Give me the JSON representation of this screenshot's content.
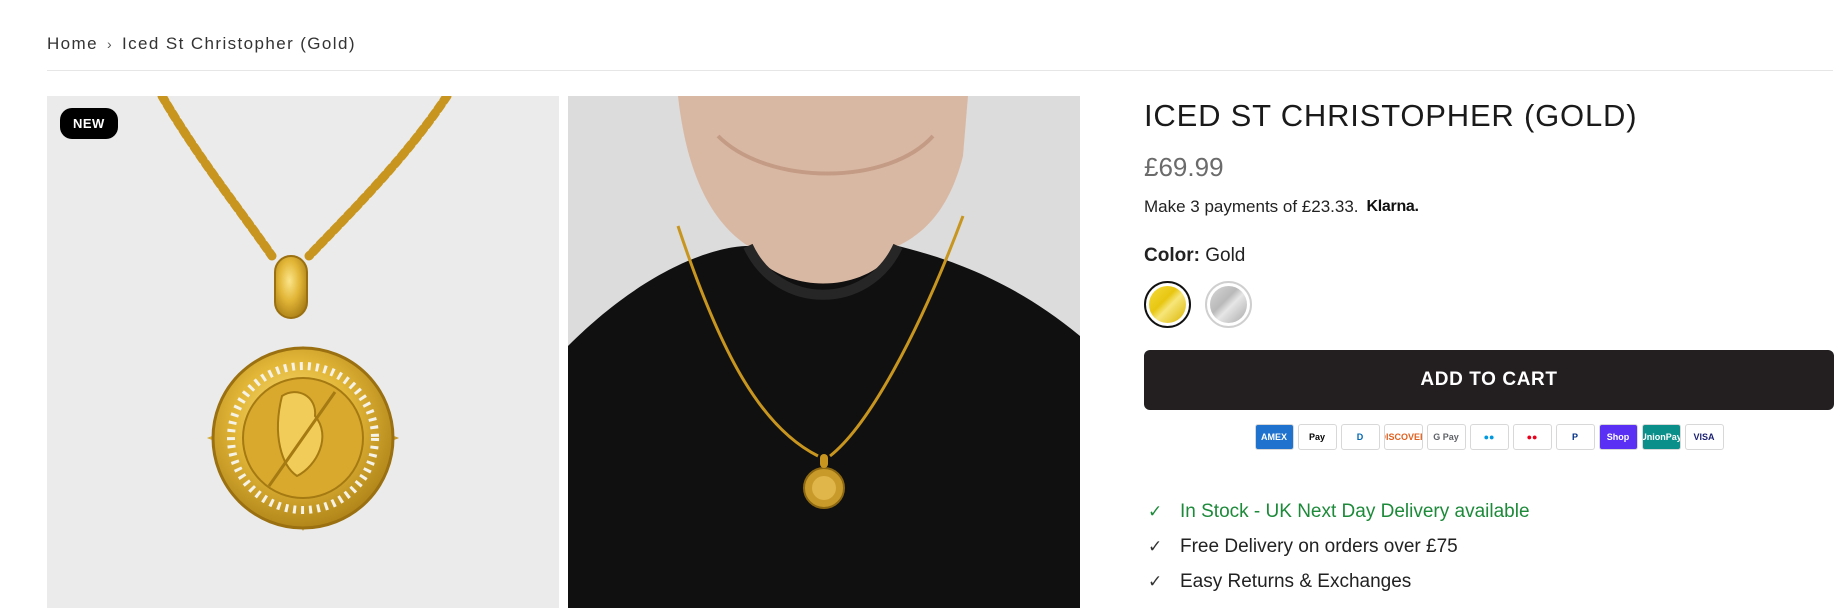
{
  "breadcrumb": {
    "home": "Home",
    "separator": "›",
    "current": "Iced St Christopher (Gold)"
  },
  "gallery": {
    "badge": "NEW",
    "images": [
      "gold-pendant-necklace-product-image",
      "model-wearing-necklace-image"
    ]
  },
  "product": {
    "title": "ICED ST CHRISTOPHER (GOLD)",
    "price": "£69.99",
    "klarna_text": "Make 3 payments of £23.33.",
    "klarna_logo": "Klarna.",
    "color_label": "Color:",
    "color_value": "Gold",
    "swatches": [
      {
        "name": "Gold",
        "color": "#e8c611",
        "selected": true
      },
      {
        "name": "Silver",
        "color": "#bdbdbd",
        "selected": false
      }
    ],
    "add_to_cart": "ADD TO CART"
  },
  "payments": [
    {
      "label": "AMEX",
      "bg": "#1f72cd",
      "fg": "#ffffff"
    },
    {
      "label": "Pay",
      "bg": "#ffffff",
      "fg": "#000000"
    },
    {
      "label": "D",
      "bg": "#ffffff",
      "fg": "#0066b2"
    },
    {
      "label": "DISCOVER",
      "bg": "#ffffff",
      "fg": "#e0601f"
    },
    {
      "label": "G Pay",
      "bg": "#ffffff",
      "fg": "#5f6368"
    },
    {
      "label": "●●",
      "bg": "#ffffff",
      "fg": "#0099df"
    },
    {
      "label": "●●",
      "bg": "#ffffff",
      "fg": "#eb001b"
    },
    {
      "label": "P",
      "bg": "#ffffff",
      "fg": "#003087"
    },
    {
      "label": "Shop",
      "bg": "#5a31f4",
      "fg": "#ffffff"
    },
    {
      "label": "UnionPay",
      "bg": "#0b8f8a",
      "fg": "#ffffff"
    },
    {
      "label": "VISA",
      "bg": "#ffffff",
      "fg": "#1a1f71"
    }
  ],
  "features": [
    {
      "text": "In Stock - UK Next Day Delivery available",
      "highlight": true
    },
    {
      "text": "Free Delivery on orders over £75",
      "highlight": false
    },
    {
      "text": "Easy Returns & Exchanges",
      "highlight": false
    }
  ],
  "colors": {
    "button_bg": "#231f20",
    "stock_green": "#1d8a3a",
    "price_grey": "#6b6b6b"
  }
}
